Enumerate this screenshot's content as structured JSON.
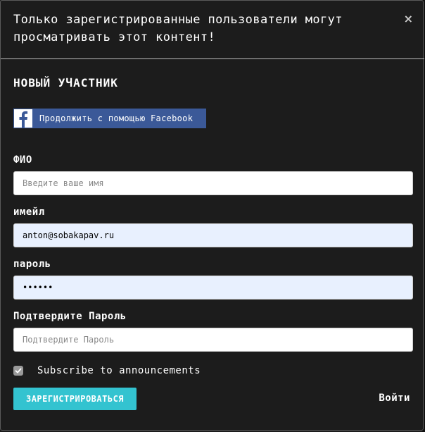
{
  "modal": {
    "title": "Только зарегистрированные пользователи могут просматривать этот контент!",
    "close_symbol": "×"
  },
  "form": {
    "section_title": "НОВЫЙ УЧАСТНИК",
    "facebook_button_label": "Продолжить с помощью Facebook",
    "name_label": "ФИО",
    "name_placeholder": "Введите ваше имя",
    "name_value": "",
    "email_label": "имейл",
    "email_value": "anton@sobakapav.ru",
    "password_label": "пароль",
    "password_value": "••••••",
    "confirm_label": "Подтвердите Пароль",
    "confirm_placeholder": "Подтвердите Пароль",
    "confirm_value": "",
    "subscribe_label": "Subscribe to announcements",
    "subscribe_checked": true,
    "register_label": "ЗАРЕГИСТРИРОВАТЬСЯ",
    "login_label": "Войти"
  },
  "colors": {
    "background": "#1c1c1c",
    "accent": "#33c3d0",
    "facebook": "#3b5998",
    "autofill": "#e8f0fe"
  },
  "icons": {
    "facebook": "facebook-icon",
    "close": "close-icon",
    "check": "check-icon"
  }
}
